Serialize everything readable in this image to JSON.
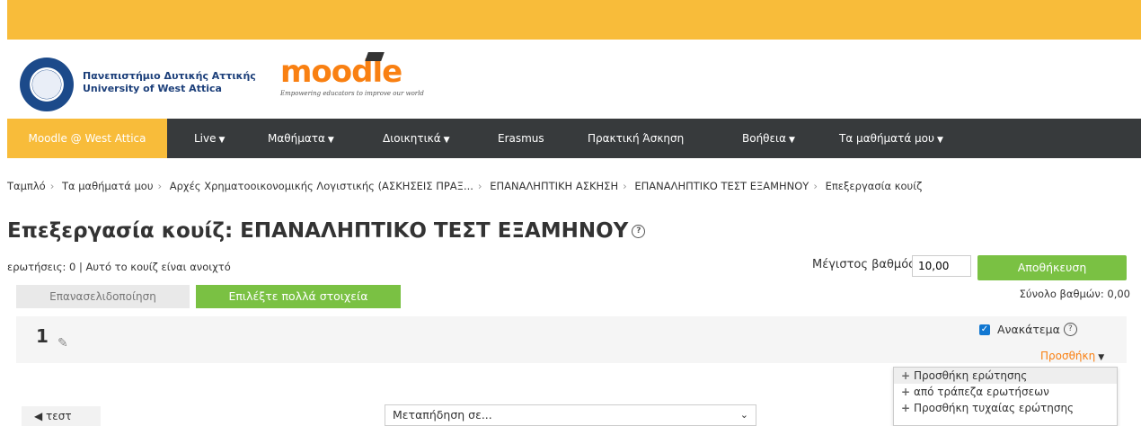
{
  "header": {
    "university_line1": "Πανεπιστήμιο Δυτικής Αττικής",
    "university_line2": "University of West Attica",
    "moodle_word": "moodle",
    "moodle_tagline": "Empowering educators to improve our world"
  },
  "navbar": {
    "brand": "Moodle @ West Attica",
    "items": [
      {
        "label": "Live",
        "dropdown": true
      },
      {
        "label": "Μαθήματα",
        "dropdown": true
      },
      {
        "label": "Διοικητικά",
        "dropdown": true
      },
      {
        "label": "Erasmus",
        "dropdown": false
      },
      {
        "label": "Πρακτική Άσκηση",
        "dropdown": false
      },
      {
        "label": "Βοήθεια",
        "dropdown": true
      },
      {
        "label": "Τα μαθήματά μου",
        "dropdown": true
      }
    ]
  },
  "breadcrumb": [
    "Ταμπλό",
    "Τα μαθήματά μου",
    "Αρχές Χρηματοοικονομικής Λογιστικής (ΑΣΚΗΣΕΙΣ ΠΡΑΞ...",
    "ΕΠΑΝΑΛΗΠΤΙΚΗ ΑΣΚΗΣΗ",
    "ΕΠΑΝΑΛΗΠΤΙΚΟ ΤΕΣΤ ΕΞΑΜΗΝΟΥ",
    "Επεξεργασία κουίζ"
  ],
  "page": {
    "title": "Επεξεργασία κουίζ: ΕΠΑΝΑΛΗΠΤΙΚΟ ΤΕΣΤ ΕΞΑΜΗΝΟΥ",
    "info": "ερωτήσεις: 0 | Αυτό το κουίζ είναι ανοιχτό",
    "max_grade_label": "Μέγιστος βαθμός",
    "max_grade_value": "10,00",
    "save_label": "Αποθήκευση",
    "repaginate_label": "Επανασελιδοποίηση",
    "select_multiple_label": "Επιλέξτε πολλά στοιχεία",
    "total_marks": "Σύνολο βαθμών: 0,00"
  },
  "section": {
    "number": "1",
    "shuffle_label": "Ανακάτεμα",
    "shuffle_checked": true,
    "add_label": "Προσθήκη"
  },
  "add_menu": {
    "items": [
      "Προσθήκη ερώτησης",
      "από τράπεζα ερωτήσεων",
      "Προσθήκη τυχαίας ερώτησης"
    ]
  },
  "footer": {
    "prev_label": "τεστ",
    "jump_placeholder": "Μεταπήδηση σε..."
  },
  "colors": {
    "accent_yellow": "#f8bc3a",
    "navbar_dark": "#373a3c",
    "button_green": "#7ac143",
    "link_orange": "#f98012",
    "checkbox_blue": "#1177d1"
  }
}
